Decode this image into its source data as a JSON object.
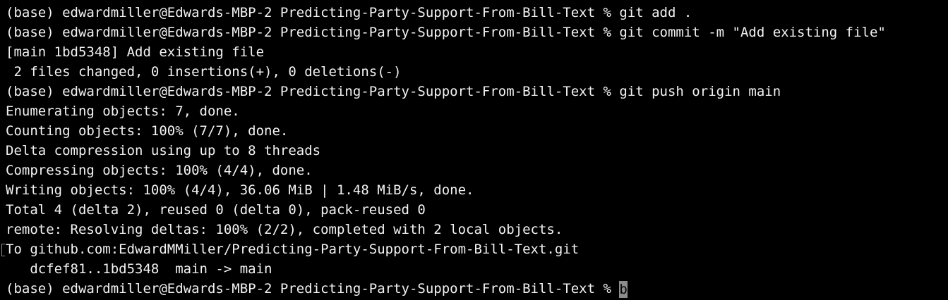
{
  "terminal": {
    "lines": [
      "(base) edwardmiller@Edwards-MBP-2 Predicting-Party-Support-From-Bill-Text % git add .",
      "(base) edwardmiller@Edwards-MBP-2 Predicting-Party-Support-From-Bill-Text % git commit -m \"Add existing file\"",
      "[main 1bd5348] Add existing file",
      " 2 files changed, 0 insertions(+), 0 deletions(-)",
      "(base) edwardmiller@Edwards-MBP-2 Predicting-Party-Support-From-Bill-Text % git push origin main",
      "Enumerating objects: 7, done.",
      "Counting objects: 100% (7/7), done.",
      "Delta compression using up to 8 threads",
      "Compressing objects: 100% (4/4), done.",
      "Writing objects: 100% (4/4), 36.06 MiB | 1.48 MiB/s, done.",
      "Total 4 (delta 2), reused 0 (delta 0), pack-reused 0",
      "remote: Resolving deltas: 100% (2/2), completed with 2 local objects.",
      "To github.com:EdwardMMiller/Predicting-Party-Support-From-Bill-Text.git",
      "   dcfef81..1bd5348  main -> main"
    ],
    "prompt": "(base) edwardmiller@Edwards-MBP-2 Predicting-Party-Support-From-Bill-Text % ",
    "input": "b"
  },
  "colors": {
    "background": "#000000",
    "text": "#f2f2f2",
    "cursor": "#8c8c8c"
  }
}
